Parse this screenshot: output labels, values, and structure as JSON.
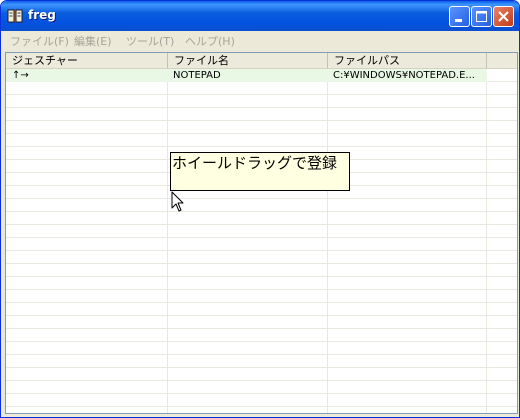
{
  "window": {
    "title": "freg"
  },
  "menu": [
    {
      "label": "ファイル(F)"
    },
    {
      "label": "編集(E)"
    },
    {
      "label": "ツール(T)"
    },
    {
      "label": "ヘルプ(H)"
    }
  ],
  "columns": [
    {
      "label": "ジェスチャー"
    },
    {
      "label": "ファイル名"
    },
    {
      "label": "ファイルパス"
    }
  ],
  "rows": [
    {
      "gesture": "↑→",
      "filename": "NOTEPAD",
      "path": "C:¥WINDOWS¥NOTEPAD.E..."
    }
  ],
  "tooltip": {
    "text": "ホイールドラッグで登録"
  },
  "icons": {
    "app": "book-icon",
    "minimize": "minimize-icon",
    "maximize": "maximize-icon",
    "close": "close-icon",
    "cursor": "mouse-pointer-icon"
  },
  "colors": {
    "titlebar": "#0b5ddc",
    "selected_row": "#e9f7e5",
    "tooltip_bg": "#ffffe1",
    "disabled_menu_text": "#a6a49a"
  }
}
